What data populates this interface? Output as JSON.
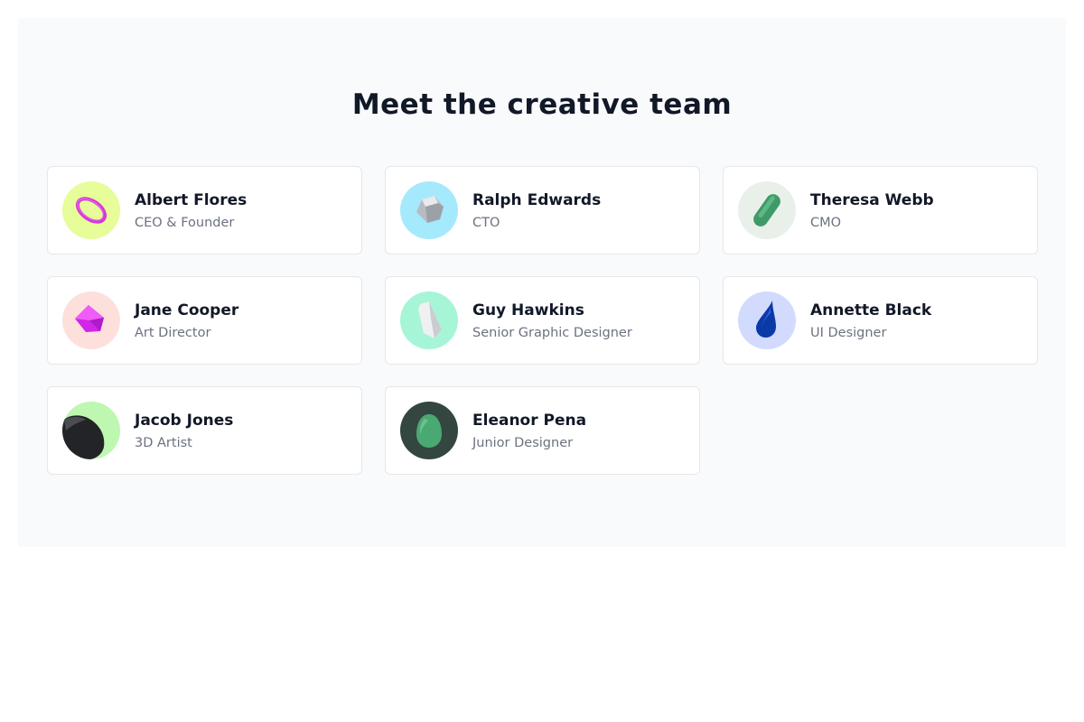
{
  "section": {
    "title": "Meet the creative team"
  },
  "team": [
    {
      "name": "Albert Flores",
      "role": "CEO & Founder",
      "avatar_bg": "#e6fd99",
      "icon": "ring-icon"
    },
    {
      "name": "Ralph Edwards",
      "role": "CTO",
      "avatar_bg": "#a5e9fc",
      "icon": "cube-icon"
    },
    {
      "name": "Theresa Webb",
      "role": "CMO",
      "avatar_bg": "#e9f0ea",
      "icon": "capsule-icon"
    },
    {
      "name": "Jane Cooper",
      "role": "Art Director",
      "avatar_bg": "#fde0dc",
      "icon": "gem-icon"
    },
    {
      "name": "Guy Hawkins",
      "role": "Senior Graphic Designer",
      "avatar_bg": "#a6f5d6",
      "icon": "crystal-icon"
    },
    {
      "name": "Annette Black",
      "role": "UI Designer",
      "avatar_bg": "#d2dafd",
      "icon": "drop-icon"
    },
    {
      "name": "Jacob Jones",
      "role": "3D Artist",
      "avatar_bg": "#bdf7b0",
      "icon": "rock-icon"
    },
    {
      "name": "Eleanor Pena",
      "role": "Junior Designer",
      "avatar_bg": "#344640",
      "icon": "egg-icon"
    }
  ]
}
